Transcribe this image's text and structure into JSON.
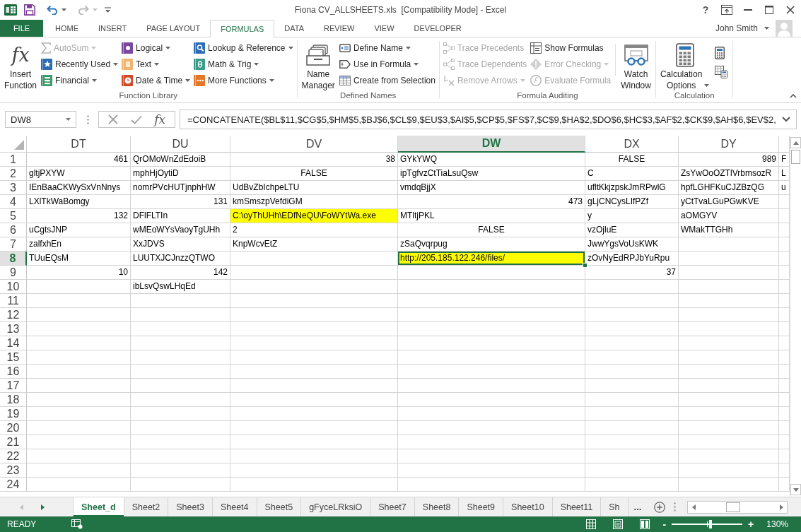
{
  "window": {
    "title": "Fiona CV_ALLSHEETS.xls  [Compatibility Mode] - Excel",
    "help": "?",
    "user": "John Smith"
  },
  "quick_access": [
    {
      "disabled": false
    },
    {
      "disabled": false,
      "dropdown": true
    },
    {
      "disabled": true,
      "dropdown": true
    }
  ],
  "ribbon": {
    "tabs": [
      {
        "label": "FILE",
        "kind": "backstage",
        "selected": false
      },
      {
        "label": "HOME",
        "kind": "tab",
        "selected": false
      },
      {
        "label": "INSERT",
        "kind": "tab",
        "selected": false
      },
      {
        "label": "PAGE LAYOUT",
        "kind": "tab",
        "selected": false
      },
      {
        "label": "FORMULAS",
        "kind": "tab",
        "selected": true
      },
      {
        "label": "DATA",
        "kind": "tab",
        "selected": false
      },
      {
        "label": "REVIEW",
        "kind": "tab",
        "selected": false
      },
      {
        "label": "VIEW",
        "kind": "tab",
        "selected": false
      },
      {
        "label": "DEVELOPER",
        "kind": "tab",
        "selected": false
      }
    ],
    "groups": [
      {
        "label": "Function Library",
        "items": [
          {
            "kind": "large",
            "label": "Insert Function",
            "glyph": "fx",
            "dropdown": false,
            "disabled": false
          },
          {
            "kind": "stack",
            "commands": [
              {
                "label": "AutoSum",
                "disabled": true,
                "dropdown": true
              },
              {
                "label": "Recently Used",
                "disabled": false,
                "dropdown": true
              },
              {
                "label": "Financial",
                "disabled": false,
                "dropdown": true
              }
            ]
          },
          {
            "kind": "stack",
            "commands": [
              {
                "label": "Logical",
                "disabled": false,
                "dropdown": true
              },
              {
                "label": "Text",
                "disabled": false,
                "dropdown": true
              },
              {
                "label": "Date & Time",
                "disabled": false,
                "dropdown": true
              }
            ]
          },
          {
            "kind": "stack",
            "commands": [
              {
                "label": "Lookup & Reference",
                "disabled": false,
                "dropdown": true
              },
              {
                "label": "Math & Trig",
                "disabled": false,
                "dropdown": true
              },
              {
                "label": "More Functions",
                "disabled": false,
                "dropdown": true
              }
            ]
          }
        ]
      },
      {
        "label": "Defined Names",
        "items": [
          {
            "kind": "large",
            "label": "Name Manager",
            "dropdown": false,
            "disabled": false
          },
          {
            "kind": "stack",
            "commands": [
              {
                "label": "Define Name",
                "disabled": false,
                "dropdown": true
              },
              {
                "label": "Use in Formula",
                "disabled": false,
                "dropdown": true
              },
              {
                "label": "Create from Selection",
                "disabled": false,
                "dropdown": false
              }
            ]
          }
        ]
      },
      {
        "label": "Formula Auditing",
        "items": [
          {
            "kind": "stack",
            "commands": [
              {
                "label": "Trace Precedents",
                "disabled": true,
                "dropdown": false
              },
              {
                "label": "Trace Dependents",
                "disabled": true,
                "dropdown": false
              },
              {
                "label": "Remove Arrows",
                "disabled": true,
                "dropdown": true
              }
            ]
          },
          {
            "kind": "stack",
            "commands": [
              {
                "label": "Show Formulas",
                "disabled": false,
                "dropdown": false
              },
              {
                "label": "Error Checking",
                "disabled": true,
                "dropdown": true
              },
              {
                "label": "Evaluate Formula",
                "disabled": true,
                "dropdown": false
              }
            ]
          },
          {
            "kind": "large",
            "label": "Watch Window",
            "dropdown": false,
            "disabled": false
          }
        ]
      },
      {
        "label": "Calculation",
        "items": [
          {
            "kind": "large",
            "label": "Calculation Options",
            "dropdown": true,
            "disabled": false
          },
          {
            "kind": "icons",
            "commands": [
              {
                "disabled": false
              },
              {
                "disabled": false
              }
            ]
          }
        ]
      }
    ]
  },
  "formula_bar": {
    "name_box": "DW8",
    "insert_function": "fx",
    "formula": "=CONCATENATE($BL$11,$CG$5,$HM$5,$BJ$6,$CL$9,$EU$3,$AI$5,$CP$5,$FS$7,$C$9,$HA$2,$DO$6,$HC$3,$AF$2,$CK$9,$AH$6,$EV$2,"
  },
  "sheet": {
    "columns": [
      {
        "label": "DT",
        "selected": false
      },
      {
        "label": "DU",
        "selected": false
      },
      {
        "label": "DV",
        "selected": false
      },
      {
        "label": "DW",
        "selected": true
      },
      {
        "label": "DX",
        "selected": false
      },
      {
        "label": "DY",
        "selected": false
      }
    ],
    "rows": [
      {
        "label": "1",
        "selected": false,
        "cells": [
          {
            "text": "461",
            "kind": "number",
            "selected": false,
            "highlighted": false
          },
          {
            "text": "QrOMoWnZdEdoiB",
            "kind": "text",
            "selected": false,
            "highlighted": false
          },
          {
            "text": "38",
            "kind": "number",
            "selected": false,
            "highlighted": false
          },
          {
            "text": "GYkYWQ",
            "kind": "text",
            "selected": false,
            "highlighted": false
          },
          {
            "text": "FALSE",
            "kind": "boolean",
            "selected": false,
            "highlighted": false
          },
          {
            "text": "989",
            "kind": "number",
            "selected": false,
            "highlighted": false
          },
          {
            "text": "F",
            "kind": "text",
            "selected": false,
            "highlighted": false
          }
        ]
      },
      {
        "label": "2",
        "selected": false,
        "cells": [
          {
            "text": "gltjPXYW",
            "kind": "text",
            "selected": false,
            "highlighted": false
          },
          {
            "text": "mphHjOytiD",
            "kind": "text",
            "selected": false,
            "highlighted": false
          },
          {
            "text": "FALSE",
            "kind": "boolean",
            "selected": false,
            "highlighted": false
          },
          {
            "text": "ipTgfvzCtTiaLsuQsw",
            "kind": "text",
            "selected": false,
            "highlighted": false
          },
          {
            "text": "C",
            "kind": "text",
            "selected": false,
            "highlighted": false
          },
          {
            "text": "ZsYwOoOZTlVrbmsozR",
            "kind": "text",
            "selected": false,
            "highlighted": false
          },
          {
            "text": "L",
            "kind": "text",
            "selected": false,
            "highlighted": false
          }
        ]
      },
      {
        "label": "3",
        "selected": false,
        "cells": [
          {
            "text": "IEnBaaCKWySxVnNnys",
            "kind": "text",
            "selected": false,
            "highlighted": false
          },
          {
            "text": "nomrPVcHUTjnphHW",
            "kind": "text",
            "selected": false,
            "highlighted": false
          },
          {
            "text": "UdBvZbIchpeLTU",
            "kind": "text",
            "selected": false,
            "highlighted": false
          },
          {
            "text": "vmdqBjjX",
            "kind": "text",
            "selected": false,
            "highlighted": false
          },
          {
            "text": "ufltKkjzpskJmRPwlG",
            "kind": "text",
            "selected": false,
            "highlighted": false
          },
          {
            "text": "hpfLGHFKuCJZBzQG",
            "kind": "text",
            "selected": false,
            "highlighted": false
          },
          {
            "text": "u",
            "kind": "text",
            "selected": false,
            "highlighted": false
          }
        ]
      },
      {
        "label": "4",
        "selected": false,
        "cells": [
          {
            "text": "LXlTkWaBomgy",
            "kind": "text",
            "selected": false,
            "highlighted": false
          },
          {
            "text": "131",
            "kind": "number",
            "selected": false,
            "highlighted": false
          },
          {
            "text": "kmSmszpVefdiGM",
            "kind": "text",
            "selected": false,
            "highlighted": false
          },
          {
            "text": "473",
            "kind": "number",
            "selected": false,
            "highlighted": false
          },
          {
            "text": "gLjCNCysLIfPZf",
            "kind": "text",
            "selected": false,
            "highlighted": false
          },
          {
            "text": "yCtTvaLGuPGwKVE",
            "kind": "text",
            "selected": false,
            "highlighted": false
          },
          null
        ]
      },
      {
        "label": "5",
        "selected": false,
        "cells": [
          {
            "text": "132",
            "kind": "number",
            "selected": false,
            "highlighted": false
          },
          {
            "text": "DFlFLTIn",
            "kind": "text",
            "selected": false,
            "highlighted": false
          },
          {
            "text": "C:\\oyThUHh\\EDfNeQU\\FoWYtWa.exe",
            "kind": "text",
            "selected": false,
            "highlighted": true
          },
          {
            "text": "MTltjPKL",
            "kind": "text",
            "selected": false,
            "highlighted": false
          },
          {
            "text": "y",
            "kind": "text",
            "selected": false,
            "highlighted": false
          },
          {
            "text": "aOMGYV",
            "kind": "text",
            "selected": false,
            "highlighted": false
          },
          null
        ]
      },
      {
        "label": "6",
        "selected": false,
        "cells": [
          {
            "text": "uCgtsJNP",
            "kind": "text",
            "selected": false,
            "highlighted": false
          },
          {
            "text": "wMEoWYsVaoyTgUHh",
            "kind": "text",
            "selected": false,
            "highlighted": false
          },
          {
            "text": "2",
            "kind": "text",
            "selected": false,
            "highlighted": false
          },
          {
            "text": "FALSE",
            "kind": "boolean",
            "selected": false,
            "highlighted": false
          },
          {
            "text": "vzOjluE",
            "kind": "text",
            "selected": false,
            "highlighted": false
          },
          {
            "text": "WMakTTGHh",
            "kind": "text",
            "selected": false,
            "highlighted": false
          },
          null
        ]
      },
      {
        "label": "7",
        "selected": false,
        "cells": [
          {
            "text": "zalfxhEn",
            "kind": "text",
            "selected": false,
            "highlighted": false
          },
          {
            "text": "XxJDVS",
            "kind": "text",
            "selected": false,
            "highlighted": false
          },
          {
            "text": "KnpWcvEtZ",
            "kind": "text",
            "selected": false,
            "highlighted": false
          },
          {
            "text": "zSaQvqrpug",
            "kind": "text",
            "selected": false,
            "highlighted": false
          },
          {
            "text": "JwwYgsVoUsKWK",
            "kind": "text",
            "selected": false,
            "highlighted": false
          },
          null,
          null
        ]
      },
      {
        "label": "8",
        "selected": true,
        "cells": [
          {
            "text": "TUuEQsM",
            "kind": "text",
            "selected": false,
            "highlighted": false
          },
          {
            "text": "LUUTXJCJnzzQTWO",
            "kind": "text",
            "selected": false,
            "highlighted": false
          },
          null,
          {
            "text": "http://205.185.122.246/files/",
            "kind": "text",
            "selected": true,
            "highlighted": true
          },
          {
            "text": "zOvNyEdRPJbYuRpu",
            "kind": "text",
            "selected": false,
            "highlighted": false
          },
          null,
          null
        ]
      },
      {
        "label": "9",
        "selected": false,
        "cells": [
          {
            "text": "10",
            "kind": "number",
            "selected": false,
            "highlighted": false
          },
          {
            "text": "142",
            "kind": "number",
            "selected": false,
            "highlighted": false
          },
          null,
          null,
          {
            "text": "37",
            "kind": "number",
            "selected": false,
            "highlighted": false
          },
          null,
          null
        ]
      },
      {
        "label": "10",
        "selected": false,
        "cells": [
          null,
          {
            "text": "ibLsvQswLHqEd",
            "kind": "text",
            "selected": false,
            "highlighted": false
          },
          null,
          null,
          null,
          null,
          null
        ]
      },
      {
        "label": "11",
        "selected": false
      },
      {
        "label": "12",
        "selected": false
      },
      {
        "label": "13",
        "selected": false
      },
      {
        "label": "14",
        "selected": false
      },
      {
        "label": "15",
        "selected": false
      },
      {
        "label": "16",
        "selected": false
      },
      {
        "label": "17",
        "selected": false
      },
      {
        "label": "18",
        "selected": false
      },
      {
        "label": "19",
        "selected": false
      },
      {
        "label": "20",
        "selected": false
      },
      {
        "label": "21",
        "selected": false
      },
      {
        "label": "22",
        "selected": false
      },
      {
        "label": "23",
        "selected": false
      },
      {
        "label": "24",
        "selected": false
      }
    ]
  },
  "sheet_tabs": {
    "nav": [
      {
        "disabled": true
      },
      {
        "disabled": false
      }
    ],
    "tabs": [
      {
        "label": "Sheet_d",
        "selected": true
      },
      {
        "label": "Sheet2",
        "selected": false
      },
      {
        "label": "Sheet3",
        "selected": false
      },
      {
        "label": "Sheet4",
        "selected": false
      },
      {
        "label": "Sheet5",
        "selected": false
      },
      {
        "label": "gFyceLRksiO",
        "selected": false
      },
      {
        "label": "Sheet7",
        "selected": false
      },
      {
        "label": "Sheet8",
        "selected": false
      },
      {
        "label": "Sheet9",
        "selected": false
      },
      {
        "label": "Sheet10",
        "selected": false
      },
      {
        "label": "Sheet11",
        "selected": false
      },
      {
        "label": "Sh",
        "selected": false
      }
    ],
    "more": "..."
  },
  "status_bar": {
    "status": "READY",
    "zoom_out": "-",
    "zoom_in": "+",
    "zoom": {
      "level": 0.55,
      "reading": "130%"
    }
  }
}
